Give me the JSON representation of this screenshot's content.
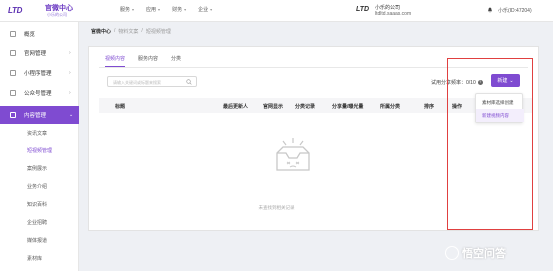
{
  "brand": {
    "mark": "LTD",
    "title": "官微中心",
    "subtitle": "小乐的公司"
  },
  "topnav": [
    {
      "label": "服务"
    },
    {
      "label": "应用"
    },
    {
      "label": "财务"
    },
    {
      "label": "企业"
    }
  ],
  "company": {
    "mark": "LTD",
    "name": "小乐的公司",
    "domain": "ltdltd.saaas.com"
  },
  "user": {
    "label": "小乐(ID:47204)"
  },
  "sidebar": {
    "items": [
      {
        "label": "概览"
      },
      {
        "label": "官网管理"
      },
      {
        "label": "小程序管理"
      },
      {
        "label": "公众号管理"
      },
      {
        "label": "内容管理"
      }
    ],
    "subitems": [
      {
        "label": "资讯文章"
      },
      {
        "label": "短视频管理"
      },
      {
        "label": "案例展示"
      },
      {
        "label": "业务介绍"
      },
      {
        "label": "知识百科"
      },
      {
        "label": "企业招聘"
      },
      {
        "label": "媒体报道"
      },
      {
        "label": "素材库"
      }
    ]
  },
  "breadcrumb": [
    "官微中心",
    "/",
    "物料文案",
    "/",
    "短视频管理"
  ],
  "tabs": [
    {
      "label": "视频内容"
    },
    {
      "label": "服务内容"
    },
    {
      "label": "分类"
    }
  ],
  "search": {
    "placeholder": "请输入关键词或标题来搜索"
  },
  "trial": {
    "label": "试用分享频率：0/10"
  },
  "new_button": {
    "label": "新建"
  },
  "table": {
    "headers": [
      "标题",
      "最后更新人",
      "官网显示",
      "分类记录",
      "分享量/曝光量",
      "所属分类",
      "排序",
      "操作"
    ]
  },
  "empty": {
    "text": "未查找到相关记录"
  },
  "dropdown": {
    "items": [
      "素材库选择创建",
      "新建视频内容"
    ]
  },
  "watermark": {
    "text": "悟空问答"
  },
  "colors": {
    "accent": "#7f4bd1",
    "highlight_border": "#e04040"
  }
}
